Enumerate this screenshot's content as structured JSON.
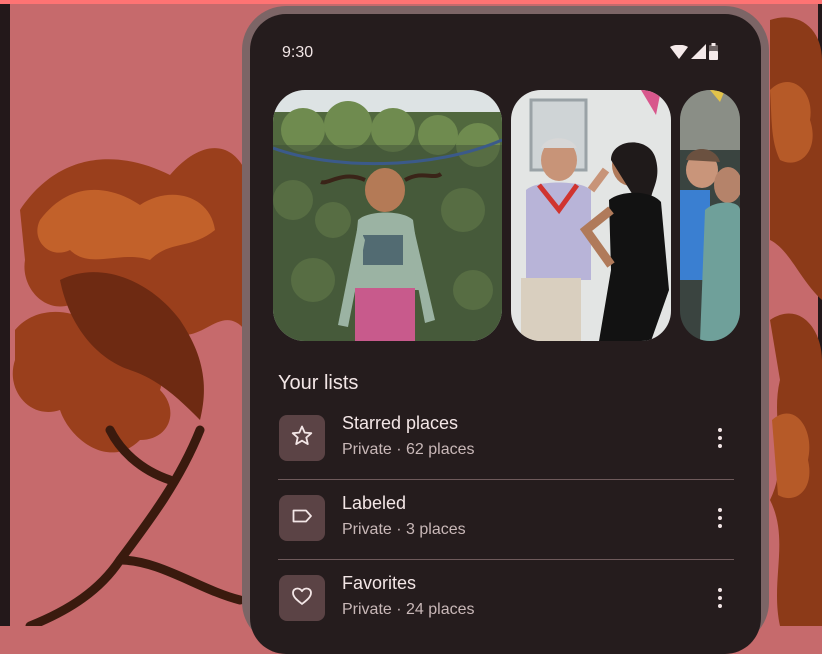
{
  "status_bar": {
    "time": "9:30",
    "icons": [
      "wifi-icon",
      "cellular-signal-icon",
      "battery-icon"
    ]
  },
  "photos": [
    {
      "subject": "girl-jumping-on-trampoline"
    },
    {
      "subject": "man-dancing-with-woman"
    },
    {
      "subject": "two-women-hugging"
    }
  ],
  "lists_section": {
    "title": "Your lists",
    "items": [
      {
        "name": "Starred places",
        "meta": "Private · 62 places",
        "icon": "star-icon"
      },
      {
        "name": "Labeled",
        "meta": "Private · 3 places",
        "icon": "label-icon"
      },
      {
        "name": "Favorites",
        "meta": "Private · 24 places",
        "icon": "heart-icon"
      }
    ]
  },
  "colors": {
    "background": "#c66a6c",
    "screen": "#251c1d",
    "icon_box": "#5b4345",
    "text_primary": "#f3e6e6",
    "text_secondary": "#c9b8b8"
  }
}
